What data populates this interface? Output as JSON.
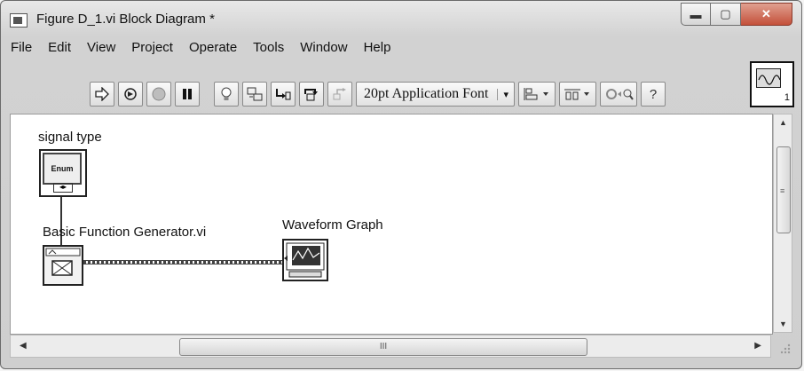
{
  "window": {
    "title": "Figure D_1.vi Block Diagram *",
    "minimize_glyph": "▬",
    "maximize_glyph": "▢",
    "close_glyph": "✕"
  },
  "menu": [
    "File",
    "Edit",
    "View",
    "Project",
    "Operate",
    "Tools",
    "Window",
    "Help"
  ],
  "toolbar": {
    "run_icon": "run-arrow-icon",
    "font_selector": "20pt Application Font",
    "font_caret": "▾",
    "help_glyph": "?"
  },
  "connector_pane": {
    "terminal_number": "1"
  },
  "diagram": {
    "signal_type_label": "signal type",
    "enum_text": "Enum",
    "enum_arrows": "◂▸",
    "function_generator_label": "Basic Function Generator.vi",
    "waveform_graph_label": "Waveform Graph"
  },
  "scrollbars": {
    "up": "▲",
    "down": "▼",
    "left": "◀",
    "right": "▶",
    "grip_h": "III",
    "grip_v": "≡"
  },
  "colors": {
    "close_button": "#c4503a",
    "canvas": "#ffffff"
  }
}
